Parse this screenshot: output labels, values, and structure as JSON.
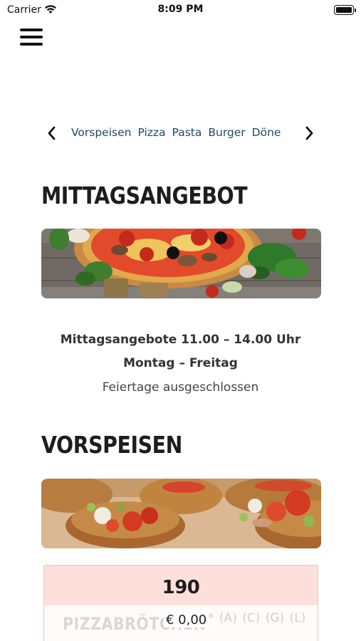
{
  "status_bar": {
    "carrier": "Carrier",
    "time": "8:09 PM",
    "icons": [
      "wifi-icon",
      "battery-icon"
    ]
  },
  "header": {
    "menu_icon": "hamburger-menu-icon"
  },
  "category_nav": {
    "prev_icon": "chevron-left-icon",
    "next_icon": "chevron-right-icon",
    "items": [
      "Vorspeisen",
      "Pizza",
      "Pasta",
      "Burger",
      "Döne"
    ]
  },
  "sections": {
    "mittag": {
      "title": "MITTAGSANGEBOT",
      "info_line1": "Mittagsangebote 11.00 – 14.00 Uhr",
      "info_line2": "Montag – Freitag",
      "info_line3": "Feiertage ausgeschlossen"
    },
    "vorspeisen": {
      "title": "VORSPEISEN"
    }
  },
  "menu_item": {
    "number": "190",
    "name": "PIZZABRÖTCHEN",
    "price": "€ 0,00",
    "allergens": "* (A) (C) (G) (L)"
  },
  "colors": {
    "nav_text": "#1f4a5a",
    "card_background": "#fde0dc",
    "title_text": "#1d1d1d"
  }
}
